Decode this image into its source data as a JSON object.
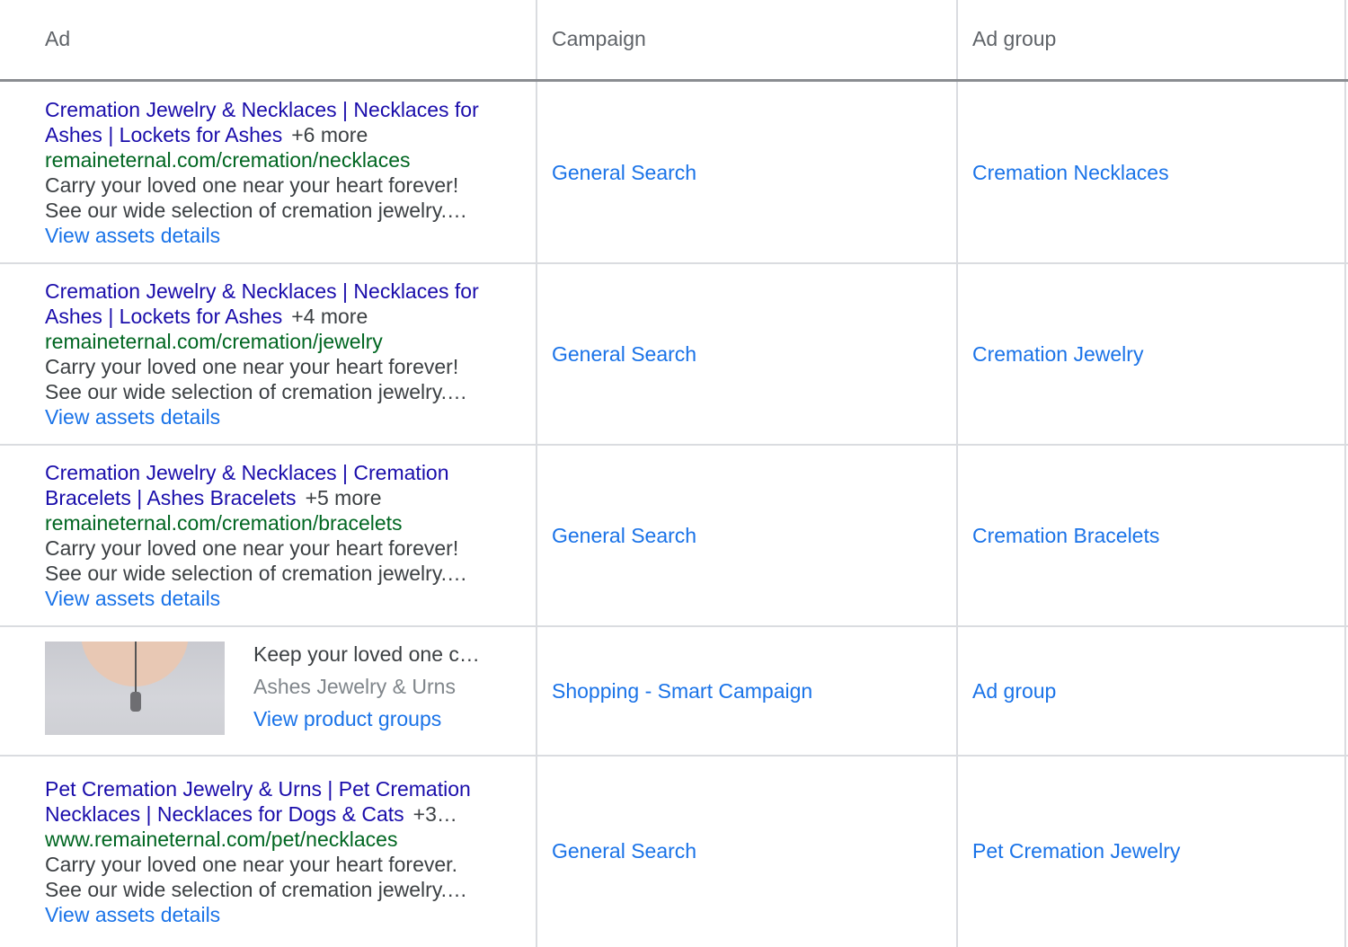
{
  "columns": {
    "ad": "Ad",
    "campaign": "Campaign",
    "ad_group": "Ad group"
  },
  "rows": [
    {
      "headline": "Cremation Jewelry & Necklaces | Necklaces for Ashes | Lockets for Ashes",
      "more": "+6 more",
      "url": "remaineternal.com/cremation/necklaces",
      "desc1": "Carry your loved one near your heart forever!",
      "desc2": "See our wide selection of cremation jewelry.…",
      "link": "View assets details",
      "campaign": "General Search",
      "ad_group": "Cremation Necklaces"
    },
    {
      "headline": "Cremation Jewelry & Necklaces | Necklaces for Ashes | Lockets for Ashes",
      "more": "+4 more",
      "url": "remaineternal.com/cremation/jewelry",
      "desc1": "Carry your loved one near your heart forever!",
      "desc2": "See our wide selection of cremation jewelry.…",
      "link": "View assets details",
      "campaign": "General Search",
      "ad_group": "Cremation Jewelry"
    },
    {
      "headline": "Cremation Jewelry & Necklaces | Cremation Bracelets | Ashes Bracelets",
      "more": "+5 more",
      "url": "remaineternal.com/cremation/bracelets",
      "desc1": "Carry your loved one near your heart forever!",
      "desc2": "See our wide selection of cremation jewelry.…",
      "link": "View assets details",
      "campaign": "General Search",
      "ad_group": "Cremation Bracelets"
    },
    {
      "shopping_title": "Keep your loved one c…",
      "shopping_store": "Ashes Jewelry & Urns",
      "link": "View product groups",
      "campaign": "Shopping - Smart Campaign",
      "ad_group": "Ad group"
    },
    {
      "headline": "Pet Cremation Jewelry & Urns | Pet Cremation Necklaces | Necklaces for Dogs & Cats",
      "more": "+3…",
      "url": "www.remaineternal.com/pet/necklaces",
      "desc1": "Carry your loved one near your heart forever.",
      "desc2": "See our wide selection of cremation jewelry.…",
      "link": "View assets details",
      "campaign": "General Search",
      "ad_group": "Pet Cremation Jewelry"
    }
  ]
}
